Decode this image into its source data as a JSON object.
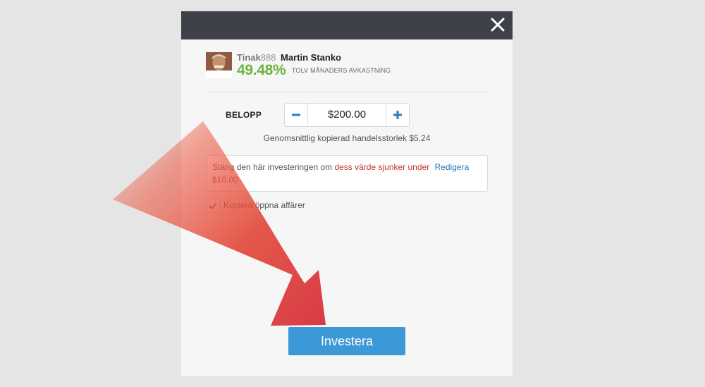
{
  "modal": {
    "close_icon": "close-icon",
    "header_color": "#3e4148"
  },
  "trader": {
    "username": "Tinak",
    "username_suffix": "888",
    "full_name": "Martin Stanko",
    "gain": "49.48%",
    "gain_label": "TOLV MÅNADERS AVKASTNING",
    "gain_color": "#6db33f"
  },
  "amount": {
    "label": "BELOPP",
    "value": "$200.00",
    "minus_icon": "minus-icon",
    "plus_icon": "plus-icon"
  },
  "avg_trade_size": "Genomsnittlig kopierad handelsstorlek $5.24",
  "stop_loss": {
    "text_prefix": "Stäng den här investeringen om",
    "text_highlight": "dess värde sjunker under",
    "edit_label": "Redigera",
    "value": "$10.00"
  },
  "copy_open": {
    "label": "Kopiera öppna affärer",
    "checked": true
  },
  "invest_button": {
    "label": "Investera",
    "color": "#3d98d8"
  },
  "overlay": {
    "icon": "curved-arrow-icon",
    "color": "#e0413a"
  }
}
